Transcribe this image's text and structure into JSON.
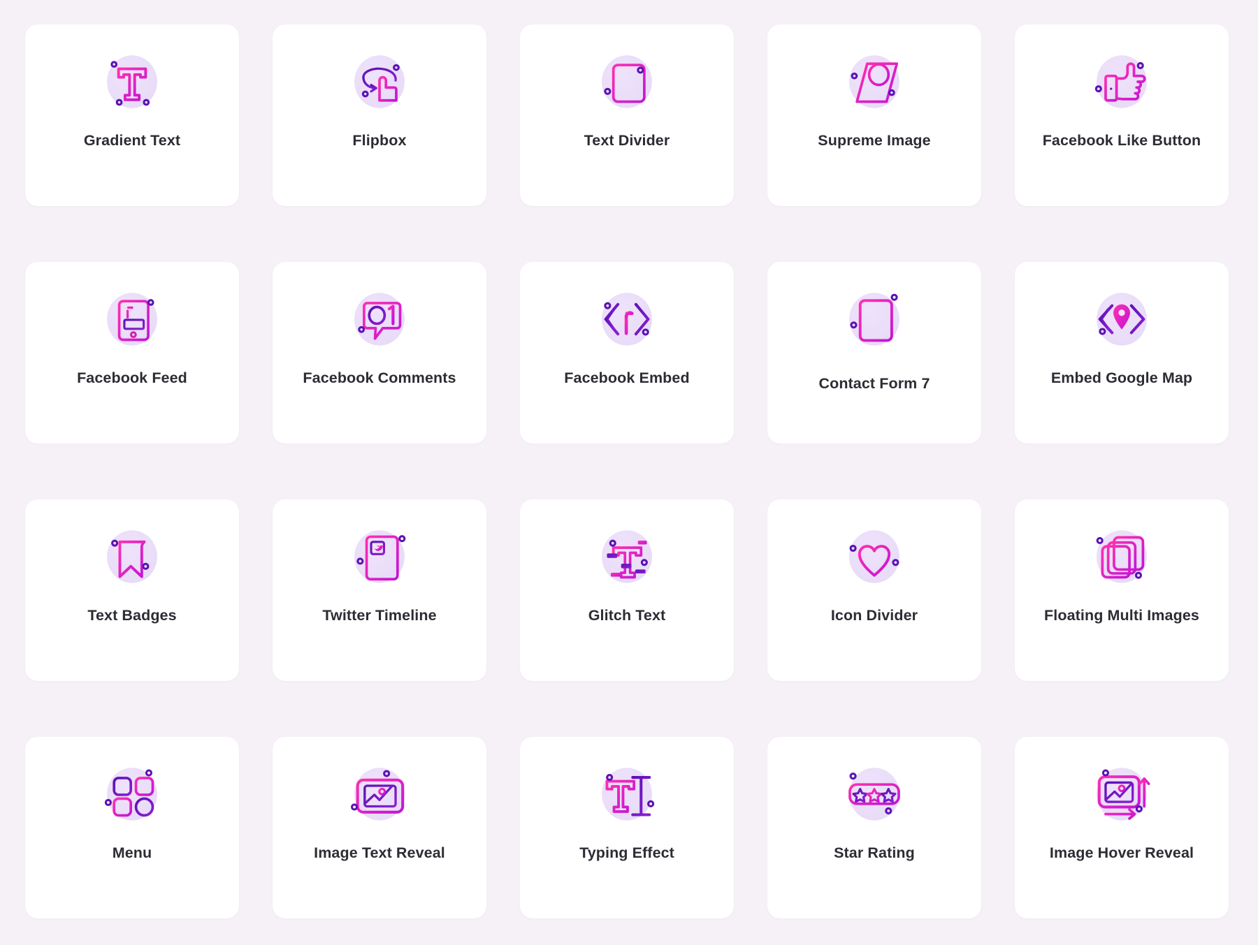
{
  "page": {
    "background_color": "#f6f1f7",
    "card_color": "#ffffff",
    "label_color": "#2e2b33",
    "icon_circle_color": "#ece0f8",
    "accent_pink": "#e832c8",
    "accent_magenta": "#f026a8",
    "accent_purple": "#5b12b4",
    "columns": 5,
    "rows": 4
  },
  "cards": [
    {
      "id": "gradient-text",
      "label": "Gradient Text",
      "icon": "gradient-text-icon"
    },
    {
      "id": "flipbox",
      "label": "Flipbox",
      "icon": "flipbox-icon"
    },
    {
      "id": "text-divider",
      "label": "Text Divider",
      "icon": "text-divider-icon"
    },
    {
      "id": "supreme-image",
      "label": "Supreme Image",
      "icon": "supreme-image-icon"
    },
    {
      "id": "facebook-like-button",
      "label": "Facebook Like Button",
      "icon": "thumbs-up-icon"
    },
    {
      "id": "facebook-feed",
      "label": "Facebook Feed",
      "icon": "facebook-feed-icon"
    },
    {
      "id": "facebook-comments",
      "label": "Facebook Comments",
      "icon": "comment-bubble-icon"
    },
    {
      "id": "facebook-embed",
      "label": "Facebook Embed",
      "icon": "code-brackets-f-icon"
    },
    {
      "id": "contact-form-7",
      "label": "Contact Form 7",
      "icon": "form-document-icon"
    },
    {
      "id": "embed-google-map",
      "label": "Embed Google Map",
      "icon": "code-brackets-pin-icon"
    },
    {
      "id": "text-badges",
      "label": "Text Badges",
      "icon": "bookmark-icon"
    },
    {
      "id": "twitter-timeline",
      "label": "Twitter Timeline",
      "icon": "twitter-document-icon"
    },
    {
      "id": "glitch-text",
      "label": "Glitch Text",
      "icon": "glitch-text-icon"
    },
    {
      "id": "icon-divider",
      "label": "Icon Divider",
      "icon": "heart-divider-icon"
    },
    {
      "id": "floating-multi-images",
      "label": "Floating Multi Images",
      "icon": "stacked-pages-icon"
    },
    {
      "id": "menu",
      "label": "Menu",
      "icon": "grid-shapes-icon"
    },
    {
      "id": "image-text-reveal",
      "label": "Image Text Reveal",
      "icon": "picture-frame-icon"
    },
    {
      "id": "typing-effect",
      "label": "Typing Effect",
      "icon": "typing-caret-icon"
    },
    {
      "id": "star-rating",
      "label": "Star Rating",
      "icon": "three-stars-icon"
    },
    {
      "id": "image-hover-reveal",
      "label": "Image Hover Reveal",
      "icon": "picture-arrows-icon"
    }
  ]
}
